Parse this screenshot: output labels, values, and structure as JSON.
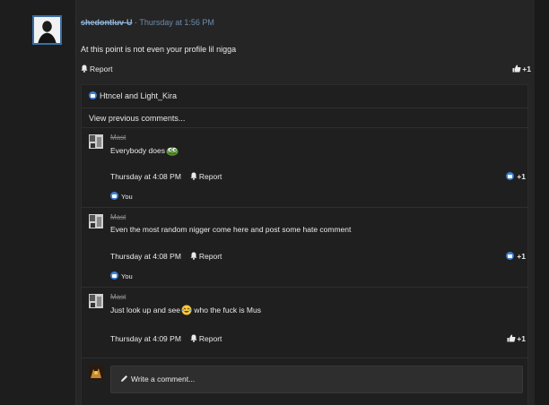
{
  "post": {
    "username": "shedontluv-U",
    "separator": "·",
    "timestamp": "Thursday at 1:56 PM",
    "body": "At this point is not even your profile lil nigga",
    "report_label": "Report",
    "like_count": "+1"
  },
  "comments_section": {
    "liked_by": "Htncel and Light_Kira",
    "view_previous": "View previous comments..."
  },
  "comments": [
    {
      "author": "Mast",
      "text": "Everybody does",
      "emoji": "pepe-emoji",
      "time": "Thursday at 4:08 PM",
      "report_label": "Report",
      "like_count": "+1",
      "liked_by": "You"
    },
    {
      "author": "Mast",
      "text": "Even the most random nigger come here and post some hate comment",
      "time": "Thursday at 4:08 PM",
      "report_label": "Report",
      "like_count": "+1",
      "liked_by": "You"
    },
    {
      "author": "Mast",
      "text_before": "Just look up and see",
      "emoji": "laughing-emoji",
      "text_after": " who the fuck is Mus",
      "time": "Thursday at 4:09 PM",
      "report_label": "Report",
      "like_count": "+1"
    }
  ],
  "write_comment": {
    "placeholder": "Write a comment..."
  },
  "colors": {
    "background": "#1a1a1a",
    "panel": "#252525",
    "username": "#8fb3d9",
    "timestamp": "#6e8cb0",
    "like_blue": "#3d7fd1"
  }
}
